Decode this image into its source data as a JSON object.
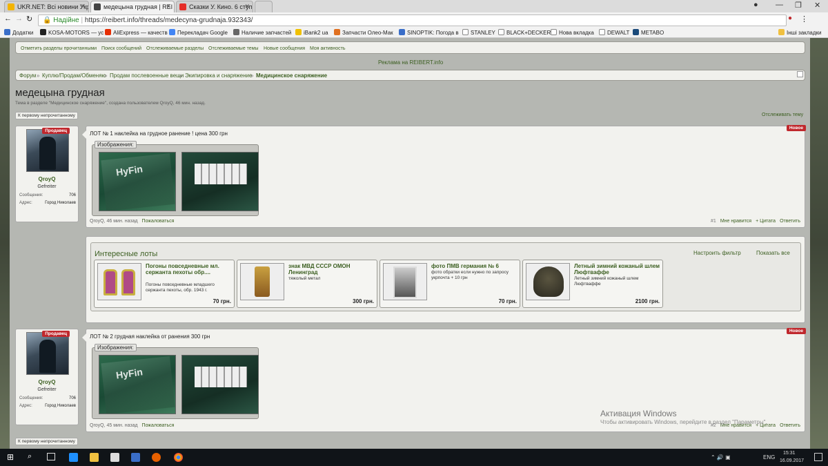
{
  "browser": {
    "tabs": [
      {
        "label": "UKR.NET: Всі новини Укр",
        "color": "#f4b400",
        "active": false
      },
      {
        "label": "медецына грудная | REI",
        "color": "#444",
        "active": true
      },
      {
        "label": "Сказки У. Кино. 6 ступ.",
        "color": "#e52d27",
        "active": false
      }
    ],
    "secure_label": "Надійне",
    "url": "https://reibert.info/threads/medecyna-grudnaja.932343/",
    "bookmarks": [
      "Додатки",
      "KOSA-MOTORS — ус",
      "AliExpress — качеств",
      "Перекладач Google",
      "Наличие запчастей",
      "iBank2 ua",
      "Запчасти Олео-Мак",
      "SINOPTIK: Погода в",
      "STANLEY",
      "BLACK+DECKER",
      "Нова вкладка",
      "DEWALT",
      "METABO",
      "Інші закладки"
    ]
  },
  "nav": {
    "links": [
      "Отметить разделы прочитанными",
      "Поиск сообщений",
      "Отслеживаемые разделы",
      "Отслеживаемые темы",
      "Новые сообщения",
      "Моя активность"
    ]
  },
  "ad_text": "Реклама на REIBERT.info",
  "breadcrumb": [
    "Форум",
    "Куплю/Продам/Обменяю",
    "Продам послевоенные вещи",
    "Экипировка и снаряжение",
    "Медицинское снаряжение"
  ],
  "thread": {
    "title": "медецына грудная",
    "meta": "Тема в разделе \"Медицинское снаряжение\", создана пользователем QroyQ, 46 мин. назад.",
    "first_unread": "К первому непрочитанному",
    "watch": "Отслеживать тему"
  },
  "posts": [
    {
      "badge": "Новое",
      "title": "ЛОТ № 1 наклейка на грудное ранение ! цена 300 грн",
      "images_label": "Изображения:",
      "user": "QroyQ",
      "time": "46 мин. назад",
      "report": "Пожаловаться",
      "num": "#1",
      "like": "Мне нравится",
      "quote": "+ Цитата",
      "reply": "Ответить"
    },
    {
      "badge": "Новое",
      "title": "ЛОТ № 2 грудная наклейка от ранения 300 грн",
      "images_label": "Изображения:",
      "user": "QroyQ",
      "time": "45 мин. назад",
      "report": "Пожаловаться",
      "num": "#2",
      "like": "Мне нравится",
      "quote": "+ Цитата",
      "reply": "Ответить"
    }
  ],
  "user": {
    "name": "QroyQ",
    "rank": "Gefreiter",
    "seller_badge": "Продавец",
    "messages_label": "Сообщения:",
    "messages": "706",
    "address_label": "Адрес:",
    "address": "Город Николаев"
  },
  "lots": {
    "heading": "Интересные лоты",
    "filter": "Настроить фильтр",
    "show_all": "Показать все",
    "items": [
      {
        "title": "Погоны повседневные мл. сержанта пехоты обр....",
        "desc": "Погоны повседневные младшего сержанта пехоты, обр. 1943 г.",
        "price": "70 грн."
      },
      {
        "title": "знак МВД СССР ОМОН Ленинград",
        "desc": "тяжолый метал",
        "price": "300 грн."
      },
      {
        "title": "фото ПМВ германия № 6",
        "desc": "фото обратки если нужно по запросу укрпочта + 10 грн",
        "price": "70 грн."
      },
      {
        "title": "Летный зимний кожаный шлем Люфтваффе",
        "desc": "Летный зимний кожаный шлем Люфтваффе",
        "price": "2100 грн."
      }
    ]
  },
  "watermark": {
    "title": "Активация Windows",
    "sub": "Чтобы активировать Windows, перейдите в раздел \"Параметры\"."
  },
  "taskbar": {
    "lang": "ENG",
    "time": "15:31",
    "date": "16.09.2017"
  }
}
